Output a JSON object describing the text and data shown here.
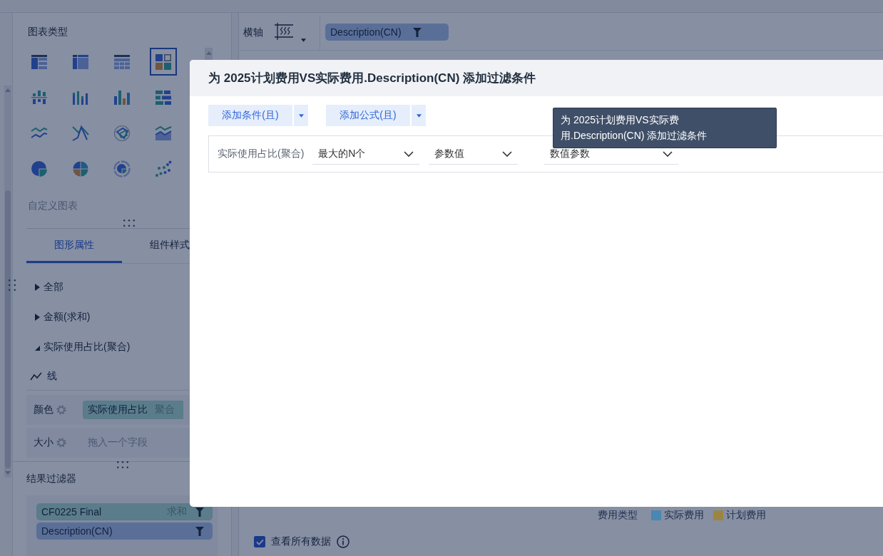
{
  "left_panel": {
    "title": "图表类型",
    "chart_types": [
      {
        "kind": "detail_table",
        "selected": false
      },
      {
        "kind": "cross_table",
        "selected": false
      },
      {
        "kind": "group_table",
        "selected": false
      },
      {
        "kind": "dashboard",
        "selected": true
      },
      {
        "kind": "split_column",
        "selected": false
      },
      {
        "kind": "grouped_column",
        "selected": false
      },
      {
        "kind": "column",
        "selected": false
      },
      {
        "kind": "bar",
        "selected": false
      },
      {
        "kind": "line",
        "selected": false
      },
      {
        "kind": "polyline",
        "selected": false
      },
      {
        "kind": "radar",
        "selected": false
      },
      {
        "kind": "area",
        "selected": false
      },
      {
        "kind": "pie",
        "selected": false
      },
      {
        "kind": "rose",
        "selected": false
      },
      {
        "kind": "ring",
        "selected": false
      },
      {
        "kind": "scatter",
        "selected": false
      }
    ],
    "custom_chart_label": "自定义图表",
    "tabs": [
      {
        "label": "图形属性",
        "selected": true
      },
      {
        "label": "组件样式",
        "selected": false
      }
    ],
    "tree": [
      {
        "label": "全部",
        "expanded": false
      },
      {
        "label": "金额(求和)",
        "expanded": false
      },
      {
        "label": "实际使用占比(聚合)",
        "expanded": true
      }
    ],
    "mark_type": "线",
    "properties": [
      {
        "kind": "assigned",
        "label": "颜色",
        "field": "实际使用占比",
        "aggregation": "聚合"
      },
      {
        "kind": "empty",
        "label": "大小",
        "placeholder": "拖入一个字段"
      }
    ]
  },
  "result_filter": {
    "title": "结果过滤器",
    "fields": [
      {
        "kind": "measure",
        "label": "CF0225 Final",
        "aggregation": "求和"
      },
      {
        "kind": "dimension",
        "label": "Description(CN)"
      }
    ]
  },
  "axis_bar": {
    "label": "横轴",
    "fields": [
      {
        "kind": "dimension",
        "label": "Description(CN)"
      }
    ]
  },
  "legend": {
    "title": "费用类型",
    "items": [
      {
        "label": "实际费用",
        "color": "#4a87b3"
      },
      {
        "label": "计划费用",
        "color": "#9c8543"
      }
    ]
  },
  "view_all": {
    "label": "查看所有数据",
    "checked": true
  },
  "dialog": {
    "title": "为 2025计划费用VS实际费用.Description(CN) 添加过滤条件",
    "actions": [
      {
        "label": "添加条件(且)"
      },
      {
        "label": "添加公式(且)"
      }
    ],
    "conditions": [
      {
        "field": "实际使用占比(聚合)",
        "selects": [
          {
            "value": "最大的N个"
          },
          {
            "value": "参数值"
          },
          {
            "value": "数值参数"
          }
        ]
      }
    ]
  },
  "tooltip": {
    "text": "为 2025计划费用VS实际费用.Description(CN) 添加过滤条件"
  }
}
